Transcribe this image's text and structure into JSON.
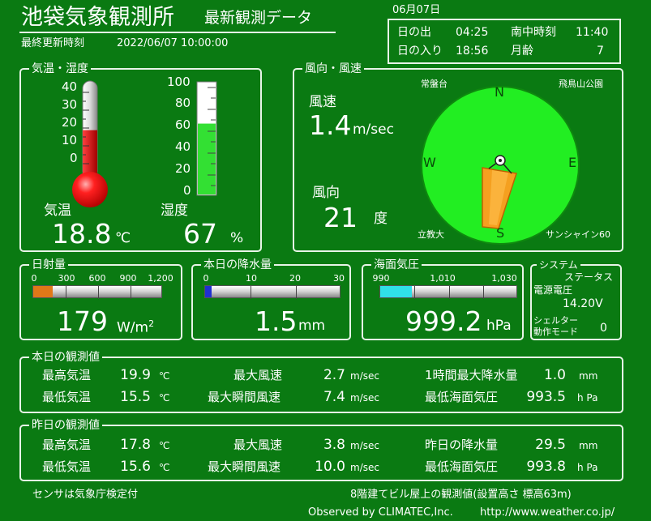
{
  "header": {
    "title": "池袋気象観測所",
    "subtitle": "最新観測データ",
    "last_update_label": "最終更新時刻",
    "last_update_value": "2022/06/07 10:00:00"
  },
  "sun": {
    "date": "06月07日",
    "sunrise_label": "日の出",
    "sunrise_value": "04:25",
    "noon_label": "南中時刻",
    "noon_value": "11:40",
    "sunset_label": "日の入り",
    "sunset_value": "18:56",
    "moon_label": "月齢",
    "moon_value": "7"
  },
  "temp_humidity": {
    "title": "気温・湿度",
    "thermo_ticks": [
      "40",
      "30",
      "20",
      "10",
      "0"
    ],
    "hygro_ticks": [
      "100",
      "80",
      "60",
      "40",
      "20",
      "0"
    ],
    "temp_label": "気温",
    "temp_value": "18.8",
    "temp_unit": "℃",
    "humidity_label": "湿度",
    "humidity_value": "67",
    "humidity_unit": "%",
    "temp_level": 18.8,
    "humidity_level": 67
  },
  "wind": {
    "title": "風向・風速",
    "speed_label": "風速",
    "speed_value": "1.4",
    "speed_unit": "m/sec",
    "dir_label": "風向",
    "dir_value": "21",
    "dir_unit": "度",
    "north": "N",
    "south": "S",
    "east": "E",
    "west": "W",
    "landmark_nw": "常盤台",
    "landmark_ne": "飛鳥山公園",
    "landmark_sw": "立教大",
    "landmark_se": "サンシャイン60",
    "direction_deg": 21
  },
  "solar": {
    "title": "日射量",
    "ticks": [
      "0",
      "300",
      "600",
      "900",
      "1,200"
    ],
    "value": "179",
    "unit": "W/m",
    "unit_sup": "2",
    "level": 179,
    "max": 1200,
    "fill_color": "#e07818"
  },
  "rain": {
    "title": "本日の降水量",
    "ticks": [
      "0",
      "10",
      "20",
      "30"
    ],
    "value": "1.5",
    "unit": "mm",
    "level": 1.5,
    "max": 30,
    "fill_color": "#2030d0"
  },
  "pressure": {
    "title": "海面気圧",
    "ticks": [
      "990",
      "1,010",
      "1,030"
    ],
    "value": "999.2",
    "unit": "hPa",
    "level": 999.2,
    "min": 990,
    "max": 1030,
    "fill_color": "#30e0e8"
  },
  "system": {
    "title": "システム",
    "status_label": "ステータス",
    "voltage_label": "電源電圧",
    "voltage_value": "14.20V",
    "shelter_label_1": "シェルター",
    "shelter_label_2": "動作モード",
    "shelter_value": "0"
  },
  "today": {
    "title": "本日の観測値",
    "rows": [
      {
        "l1": "最高気温",
        "v1": "19.9",
        "u1": "℃",
        "l2": "最大風速",
        "v2": "2.7",
        "u2": "m/sec",
        "l3": "1時間最大降水量",
        "v3": "1.0",
        "u3": "mm"
      },
      {
        "l1": "最低気温",
        "v1": "15.5",
        "u1": "℃",
        "l2": "最大瞬間風速",
        "v2": "7.4",
        "u2": "m/sec",
        "l3": "最低海面気圧",
        "v3": "993.5",
        "u3": "h Pa"
      }
    ]
  },
  "yesterday": {
    "title": "昨日の観測値",
    "rows": [
      {
        "l1": "最高気温",
        "v1": "17.8",
        "u1": "℃",
        "l2": "最大風速",
        "v2": "3.8",
        "u2": "m/sec",
        "l3": "昨日の降水量",
        "v3": "29.5",
        "u3": "mm"
      },
      {
        "l1": "最低気温",
        "v1": "15.6",
        "u1": "℃",
        "l2": "最大瞬間風速",
        "v2": "10.0",
        "u2": "m/sec",
        "l3": "最低海面気圧",
        "v3": "993.8",
        "u3": "h Pa"
      }
    ]
  },
  "footer": {
    "sensor_note": "センサは気象庁検定付",
    "location_note": "8階建てビル屋上の観測値(設置高さ 標高63m)",
    "credit": "Observed by CLIMATEC,Inc.",
    "url": "http://www.weather.co.jp/"
  }
}
